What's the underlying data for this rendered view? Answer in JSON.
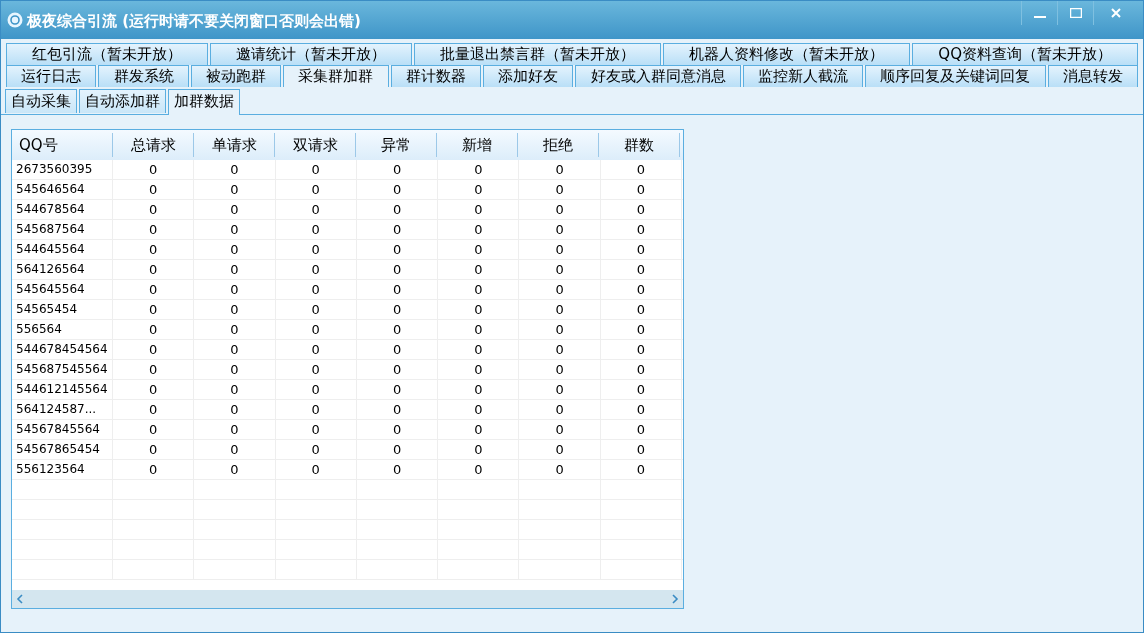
{
  "window": {
    "title": "极夜综合引流 (运行时请不要关闭窗口否则会出错)"
  },
  "tab_rows": [
    [
      {
        "label": "红包引流（暂未开放）",
        "selected": false
      },
      {
        "label": "邀请统计（暂未开放）",
        "selected": false
      },
      {
        "label": "批量退出禁言群（暂未开放）",
        "selected": false
      },
      {
        "label": "机器人资料修改（暂未开放）",
        "selected": false
      },
      {
        "label": "QQ资料查询（暂未开放）",
        "selected": false
      }
    ],
    [
      {
        "label": "运行日志",
        "selected": false
      },
      {
        "label": "群发系统",
        "selected": false
      },
      {
        "label": "被动跑群",
        "selected": false
      },
      {
        "label": "采集群加群",
        "selected": true
      },
      {
        "label": "群计数器",
        "selected": false
      },
      {
        "label": "添加好友",
        "selected": false
      },
      {
        "label": "好友或入群同意消息",
        "selected": false
      },
      {
        "label": "监控新人截流",
        "selected": false
      },
      {
        "label": "顺序回复及关键词回复",
        "selected": false
      },
      {
        "label": "消息转发",
        "selected": false
      }
    ]
  ],
  "sub_tabs": [
    {
      "label": "自动采集",
      "selected": false
    },
    {
      "label": "自动添加群",
      "selected": false
    },
    {
      "label": "加群数据",
      "selected": true
    }
  ],
  "table": {
    "columns": [
      "QQ号",
      "总请求",
      "单请求",
      "双请求",
      "异常",
      "新增",
      "拒绝",
      "群数"
    ],
    "rows": [
      {
        "qq": "2673560395",
        "values": [
          "0",
          "0",
          "0",
          "0",
          "0",
          "0",
          "0"
        ]
      },
      {
        "qq": "545646564",
        "values": [
          "0",
          "0",
          "0",
          "0",
          "0",
          "0",
          "0"
        ]
      },
      {
        "qq": "544678564",
        "values": [
          "0",
          "0",
          "0",
          "0",
          "0",
          "0",
          "0"
        ]
      },
      {
        "qq": "545687564",
        "values": [
          "0",
          "0",
          "0",
          "0",
          "0",
          "0",
          "0"
        ]
      },
      {
        "qq": "544645564",
        "values": [
          "0",
          "0",
          "0",
          "0",
          "0",
          "0",
          "0"
        ]
      },
      {
        "qq": "564126564",
        "values": [
          "0",
          "0",
          "0",
          "0",
          "0",
          "0",
          "0"
        ]
      },
      {
        "qq": "545645564",
        "values": [
          "0",
          "0",
          "0",
          "0",
          "0",
          "0",
          "0"
        ]
      },
      {
        "qq": "54565454",
        "values": [
          "0",
          "0",
          "0",
          "0",
          "0",
          "0",
          "0"
        ]
      },
      {
        "qq": "556564",
        "values": [
          "0",
          "0",
          "0",
          "0",
          "0",
          "0",
          "0"
        ]
      },
      {
        "qq": "544678454564",
        "values": [
          "0",
          "0",
          "0",
          "0",
          "0",
          "0",
          "0"
        ]
      },
      {
        "qq": "545687545564",
        "values": [
          "0",
          "0",
          "0",
          "0",
          "0",
          "0",
          "0"
        ]
      },
      {
        "qq": "544612145564",
        "values": [
          "0",
          "0",
          "0",
          "0",
          "0",
          "0",
          "0"
        ]
      },
      {
        "qq": "564124587...",
        "values": [
          "0",
          "0",
          "0",
          "0",
          "0",
          "0",
          "0"
        ]
      },
      {
        "qq": "54567845564",
        "values": [
          "0",
          "0",
          "0",
          "0",
          "0",
          "0",
          "0"
        ]
      },
      {
        "qq": "54567865454",
        "values": [
          "0",
          "0",
          "0",
          "0",
          "0",
          "0",
          "0"
        ]
      },
      {
        "qq": "556123564",
        "values": [
          "0",
          "0",
          "0",
          "0",
          "0",
          "0",
          "0"
        ]
      }
    ]
  }
}
